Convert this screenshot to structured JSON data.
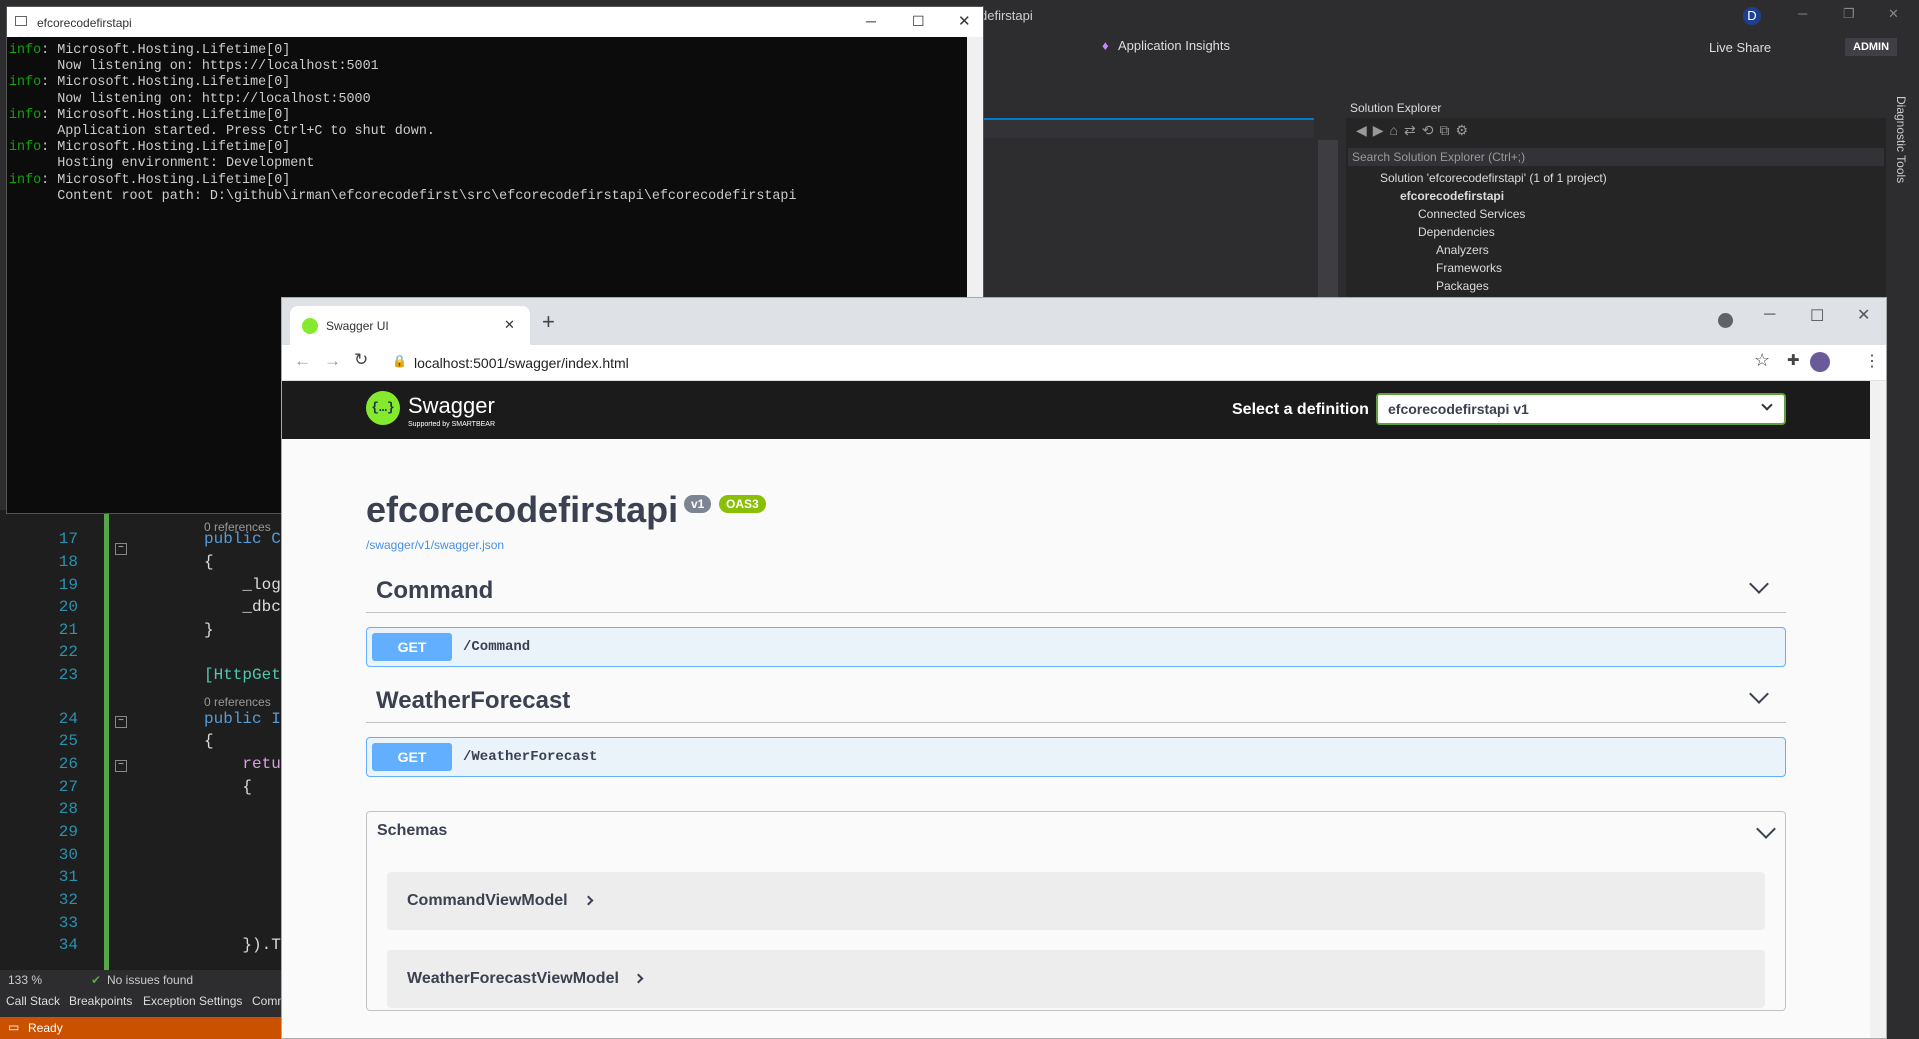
{
  "vs": {
    "title_fragment": "defirstapi",
    "app_insights": "Application Insights",
    "live_share": "Live Share",
    "user_badge": "ADMIN",
    "user_initial": "D",
    "diagnostic_tools": "Diagnostic Tools",
    "solution_explorer": {
      "title": "Solution Explorer",
      "search_placeholder": "Search Solution Explorer (Ctrl+;)",
      "items": [
        "Solution 'efcorecodefirstapi' (1 of 1 project)",
        "efcorecodefirstapi",
        "Connected Services",
        "Dependencies",
        "Analyzers",
        "Frameworks",
        "Packages"
      ]
    },
    "code_lines": [
      {
        "num": "17",
        "text": "public C"
      },
      {
        "num": "18",
        "text": "{"
      },
      {
        "num": "19",
        "text": "    _log"
      },
      {
        "num": "20",
        "text": "    _dbc"
      },
      {
        "num": "21",
        "text": "}"
      },
      {
        "num": "22",
        "text": ""
      },
      {
        "num": "23",
        "text": "[HttpGet"
      },
      {
        "num": "24",
        "text": "public I"
      },
      {
        "num": "25",
        "text": "{"
      },
      {
        "num": "26",
        "text": "    retu"
      },
      {
        "num": "27",
        "text": "    {"
      },
      {
        "num": "28",
        "text": ""
      },
      {
        "num": "29",
        "text": ""
      },
      {
        "num": "30",
        "text": ""
      },
      {
        "num": "31",
        "text": ""
      },
      {
        "num": "32",
        "text": ""
      },
      {
        "num": "33",
        "text": ""
      },
      {
        "num": "34",
        "text": "    }).T"
      }
    ],
    "references_label": "0 references",
    "zoom": "133 %",
    "issues": "No issues found",
    "bottom_tabs": [
      "Call Stack",
      "Breakpoints",
      "Exception Settings",
      "Comm"
    ],
    "status": "Ready"
  },
  "console": {
    "title": "efcorecodefirstapi",
    "lines": [
      {
        "level": "info",
        "text": ": Microsoft.Hosting.Lifetime[0]"
      },
      {
        "level": "",
        "text": "      Now listening on: https://localhost:5001"
      },
      {
        "level": "info",
        "text": ": Microsoft.Hosting.Lifetime[0]"
      },
      {
        "level": "",
        "text": "      Now listening on: http://localhost:5000"
      },
      {
        "level": "info",
        "text": ": Microsoft.Hosting.Lifetime[0]"
      },
      {
        "level": "",
        "text": "      Application started. Press Ctrl+C to shut down."
      },
      {
        "level": "info",
        "text": ": Microsoft.Hosting.Lifetime[0]"
      },
      {
        "level": "",
        "text": "      Hosting environment: Development"
      },
      {
        "level": "info",
        "text": ": Microsoft.Hosting.Lifetime[0]"
      },
      {
        "level": "",
        "text": "      Content root path: D:\\github\\irman\\efcorecodefirst\\src\\efcorecodefirstapi\\efcorecodefirstapi"
      }
    ]
  },
  "browser": {
    "tab_title": "Swagger UI",
    "url": "localhost:5001/swagger/index.html"
  },
  "swagger": {
    "logo_text": "Swagger",
    "logo_sub": "Supported by SMARTBEAR",
    "logo_glyph": "{…}",
    "definition_label": "Select a definition",
    "definition_value": "efcorecodefirstapi v1",
    "title": "efcorecodefirstapi",
    "version_badge": "v1",
    "oas_badge": "OAS3",
    "spec_url": "/swagger/v1/swagger.json",
    "tags": [
      {
        "name": "Command",
        "method": "GET",
        "path": "/Command"
      },
      {
        "name": "WeatherForecast",
        "method": "GET",
        "path": "/WeatherForecast"
      }
    ],
    "schemas_title": "Schemas",
    "models": [
      "CommandViewModel",
      "WeatherForecastViewModel"
    ]
  },
  "colors": {
    "get_blue": "#61affe",
    "oas_green": "#89bf04",
    "swagger_green": "#85ea2d",
    "vs_orange": "#ca5100"
  }
}
